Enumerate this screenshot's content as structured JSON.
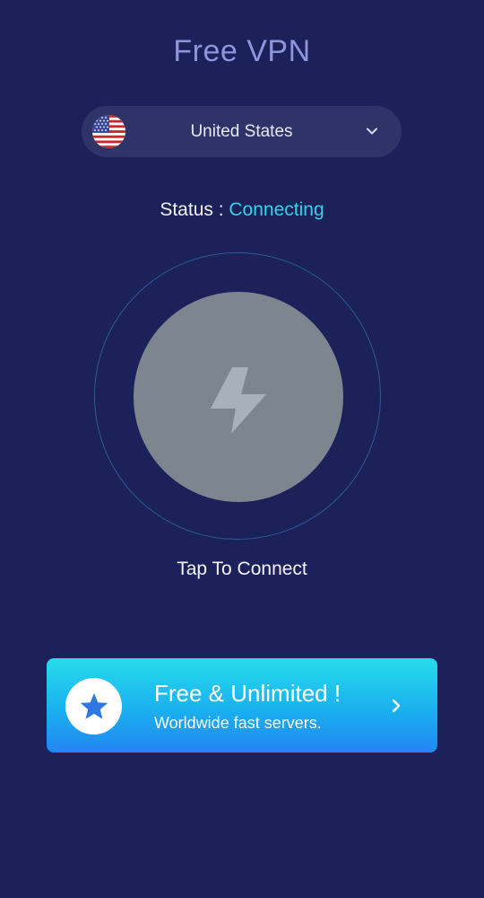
{
  "app": {
    "title": "Free VPN"
  },
  "server_selector": {
    "country": "United States",
    "flag_icon": "us-flag-icon",
    "dropdown_icon": "chevron-down-icon"
  },
  "status": {
    "label": "Status : ",
    "value": "Connecting"
  },
  "connect": {
    "icon": "lightning-bolt-icon",
    "label": "Tap To Connect"
  },
  "promo": {
    "title": "Free & Unlimited !",
    "subtitle": "Worldwide fast servers.",
    "badge_icon": "star-icon",
    "arrow_icon": "chevron-right-icon"
  },
  "colors": {
    "background": "#1c215a",
    "title": "#8d95dc",
    "selector_bg": "#2e3468",
    "status_accent": "#31d4e8",
    "connect_button": "#7d858e",
    "ring": "#2a5b96",
    "banner_top": "#27dce9",
    "banner_bottom": "#2286f2",
    "star": "#2f78e3"
  }
}
